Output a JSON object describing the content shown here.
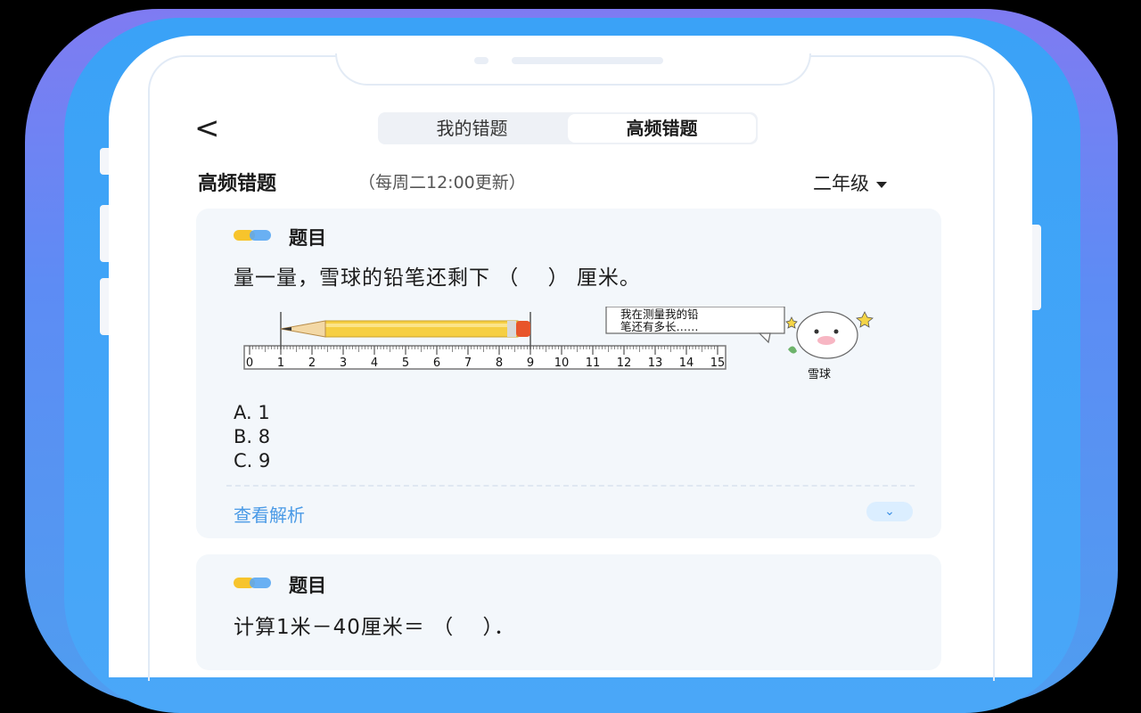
{
  "header": {
    "back_symbol": "<",
    "tabs": [
      {
        "label": "我的错题",
        "active": false
      },
      {
        "label": "高频错题",
        "active": true
      }
    ]
  },
  "section": {
    "title": "高频错题",
    "note": "（每周二12:00更新）",
    "grade": "二年级"
  },
  "cards": [
    {
      "label": "题目",
      "question": "量一量，雪球的铅笔还剩下 （　 ） 厘米。",
      "figure": {
        "ruler_ticks": [
          "0",
          "1",
          "2",
          "3",
          "4",
          "5",
          "6",
          "7",
          "8",
          "9",
          "10",
          "11",
          "12",
          "13",
          "14",
          "15"
        ],
        "pencil_from": 1,
        "pencil_to": 9,
        "speech": [
          "我在测量我的铅",
          "笔还有多长……"
        ],
        "character_name": "雪球"
      },
      "options": [
        "A. 1",
        "B. 8",
        "C. 9"
      ],
      "analysis_label": "查看解析",
      "expand_icon": "chevron-down-icon"
    },
    {
      "label": "题目",
      "question": "计算1米－40厘米＝ （　 ）．"
    }
  ],
  "colors": {
    "accent_blue": "#4a9ae6",
    "dot_yellow": "#f7c42c",
    "dot_blue": "#5aa7f2",
    "frame_blue": "#3aa2f7"
  }
}
